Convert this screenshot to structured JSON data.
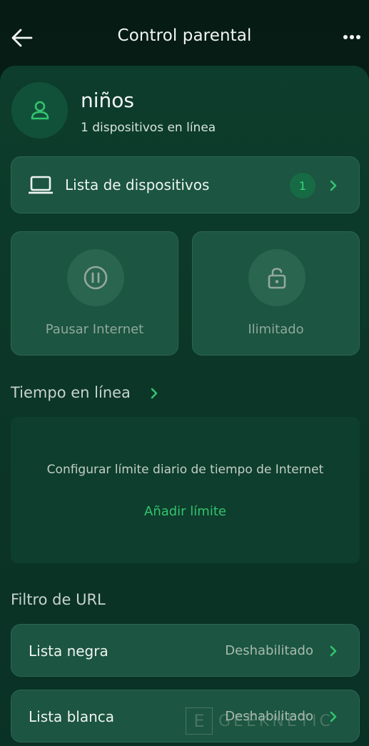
{
  "header": {
    "title": "Control parental"
  },
  "profile": {
    "name": "niños",
    "subtitle": "1 dispositivos en línea"
  },
  "devices": {
    "label": "Lista de dispositivos",
    "count": "1"
  },
  "tiles": {
    "pause_label": "Pausar Internet",
    "unlimited_label": "Ilimitado"
  },
  "online_time": {
    "title": "Tiempo en línea",
    "description": "Configurar límite diario de tiempo de Internet",
    "add_label": "Añadir límite"
  },
  "url_filter": {
    "title": "Filtro de URL",
    "items": [
      {
        "label": "Lista negra",
        "status": "Deshabilitado"
      },
      {
        "label": "Lista blanca",
        "status": "Deshabilitado"
      }
    ]
  },
  "watermark": {
    "box": "E",
    "text": "GEEKNETIC"
  },
  "colors": {
    "accent": "#33c46e",
    "background": "#061d16",
    "card": "#1c5541"
  }
}
